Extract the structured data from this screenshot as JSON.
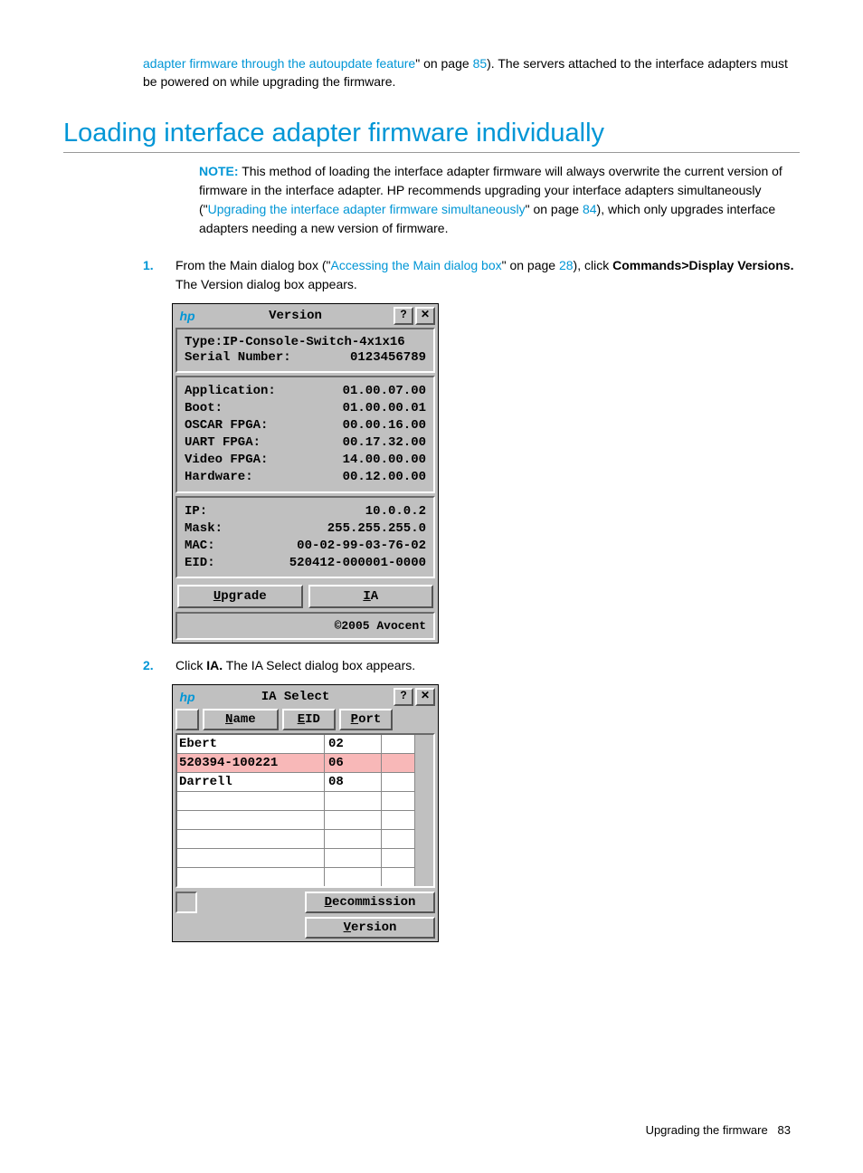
{
  "intro": {
    "link_text": "adapter firmware through the autoupdate feature",
    "quote_page_pre": "\" on page ",
    "page_ref": "85",
    "after_page": "). The servers attached to the interface adapters must be powered on while upgrading the firmware."
  },
  "heading": "Loading interface adapter firmware individually",
  "note": {
    "label": "NOTE:",
    "t1": " This method of loading the interface adapter firmware will always overwrite the current version of firmware in the interface adapter. HP recommends upgrading your interface adapters simultaneously (\"",
    "link": "Upgrading the interface adapter firmware simultaneously",
    "t2": "\" on page ",
    "page": "84",
    "t3": "), which only upgrades interface adapters needing a new version of firmware."
  },
  "steps": {
    "s1": {
      "num": "1.",
      "pre": "From the Main dialog box (\"",
      "link": "Accessing the Main dialog box",
      "mid": "\" on page ",
      "page": "28",
      "after_page": "), click ",
      "bold": "Commands>Display Versions.",
      "tail": " The Version dialog box appears."
    },
    "s2": {
      "num": "2.",
      "pre": "Click ",
      "bold": "IA.",
      "tail": " The IA Select dialog box appears."
    }
  },
  "dlg_version": {
    "title": "Version",
    "help": "?",
    "close": "✕",
    "type_label": "Type:",
    "type_value": "IP-Console-Switch-4x1x16",
    "serial_label": "Serial Number:",
    "serial_value": "0123456789",
    "rows": [
      {
        "k": "Application:",
        "v": "01.00.07.00"
      },
      {
        "k": "Boot:",
        "v": "01.00.00.01"
      },
      {
        "k": "OSCAR FPGA:",
        "v": "00.00.16.00"
      },
      {
        "k": "UART FPGA:",
        "v": "00.17.32.00"
      },
      {
        "k": "Video FPGA:",
        "v": "14.00.00.00"
      },
      {
        "k": "Hardware:",
        "v": "00.12.00.00"
      }
    ],
    "net": [
      {
        "k": "IP:",
        "v": "10.0.0.2"
      },
      {
        "k": "Mask:",
        "v": "255.255.255.0"
      },
      {
        "k": "MAC:",
        "v": "00-02-99-03-76-02"
      },
      {
        "k": "EID:",
        "v": "520412-000001-0000"
      }
    ],
    "btn_upgrade": "Upgrade",
    "btn_ia": "IA",
    "copyright": "©2005 Avocent"
  },
  "dlg_ia": {
    "title": "IA Select",
    "help": "?",
    "close": "✕",
    "col_name": "Name",
    "col_eid": "EID",
    "col_port": "Port",
    "rows": [
      {
        "name": "Ebert",
        "port": "02",
        "pink": false
      },
      {
        "name": "520394-100221",
        "port": "06",
        "pink": true
      },
      {
        "name": "Darrell",
        "port": "08",
        "pink": false
      }
    ],
    "btn_decommission": "Decommission",
    "btn_version": "Version"
  },
  "footer": {
    "section": "Upgrading the firmware",
    "page": "83"
  }
}
